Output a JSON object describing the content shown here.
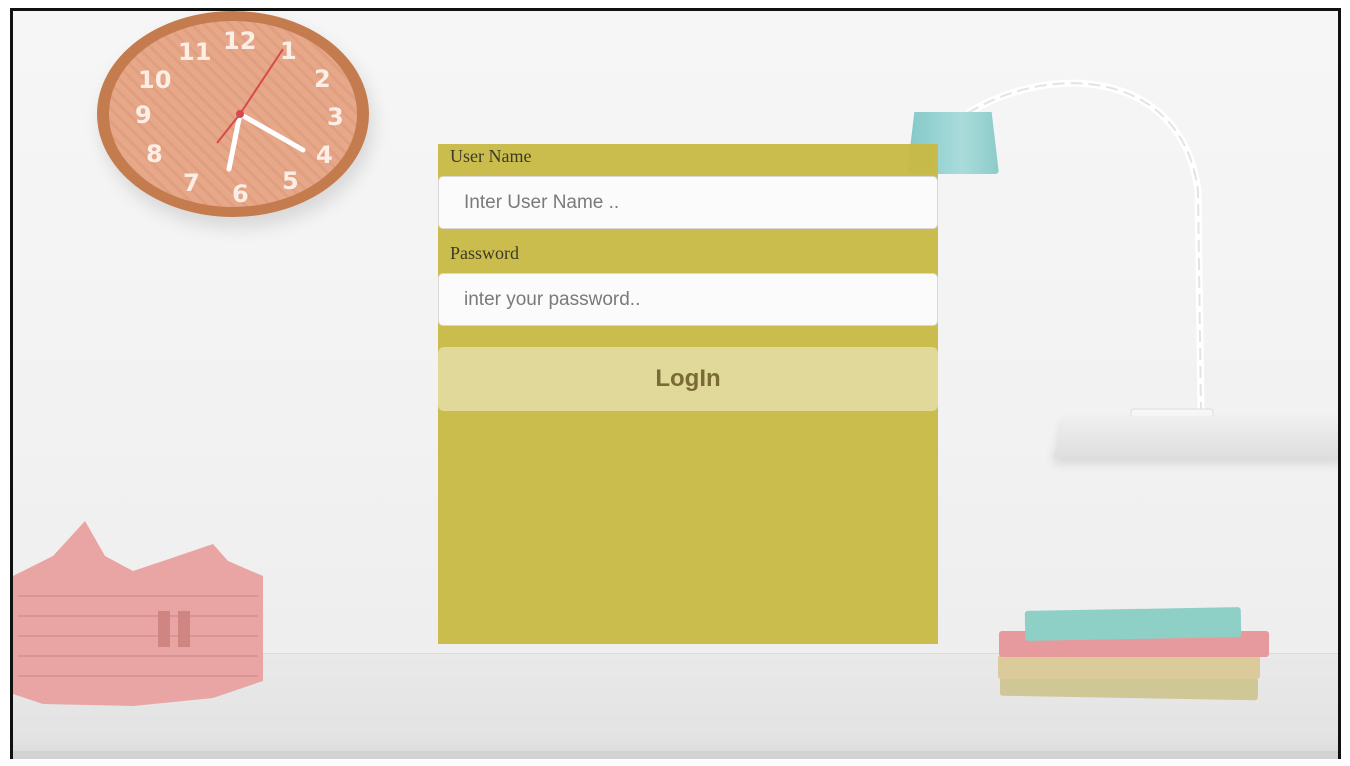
{
  "login": {
    "username_label": "User Name",
    "username_placeholder": "Inter User Name ..",
    "username_value": "",
    "password_label": "Password",
    "password_placeholder": "inter your password..",
    "password_value": "",
    "login_label": "LogIn"
  },
  "clock": {
    "numerals": [
      "12",
      "1",
      "2",
      "3",
      "4",
      "5",
      "6",
      "7",
      "8",
      "9",
      "10",
      "11"
    ]
  },
  "colors": {
    "panel": "#c8b946",
    "button_text": "#7a6a35",
    "lamp": "#8ccbc9",
    "clock_frame": "#c47c4f",
    "book_teal": "#8ed0c6",
    "book_pink": "#e79a9e",
    "castle_pink": "#e9a5a3"
  }
}
